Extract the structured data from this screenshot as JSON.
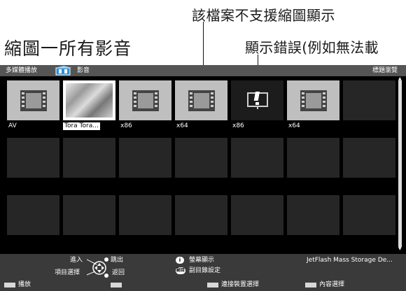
{
  "annotations": {
    "top": "該檔案不支援縮圖顯示",
    "main": "縮圖一所有影音",
    "error": "顯示錯誤(例如無法載"
  },
  "topbar": {
    "breadcrumb": "多媒體播放",
    "section": "影音",
    "right_title": "標題瀏覽"
  },
  "tiles": [
    {
      "kind": "video",
      "label": "AV"
    },
    {
      "kind": "photo",
      "label": "Tora Tora..."
    },
    {
      "kind": "video",
      "label": "x86"
    },
    {
      "kind": "video",
      "label": "x64"
    },
    {
      "kind": "error",
      "label": "x86"
    },
    {
      "kind": "video",
      "label": "x64"
    },
    {
      "kind": "empty",
      "label": ""
    }
  ],
  "help": {
    "enter": "進入",
    "jump_out": "跳出",
    "item_select": "項目選擇",
    "back": "返回",
    "info_icon": "i",
    "screen_display": "螢幕顯示",
    "sub_icon": "副目",
    "subdir_setting": "副目錄設定",
    "device": "JetFlash Mass Storage De...",
    "play": "播放",
    "connect_device": "連接裝置選擇",
    "content_select": "內容選擇"
  },
  "colors": {
    "screen_bg": "#000000",
    "topbar_bg": "#555555",
    "tile_empty": "#262626",
    "tile_video": "#bfbfbf",
    "helpbar_bg": "#3a3a3a"
  },
  "icons": {
    "video": "film-strip-icon",
    "error": "error-exclamation-icon",
    "nav": "dpad-icon",
    "media": "media-player-icon"
  }
}
